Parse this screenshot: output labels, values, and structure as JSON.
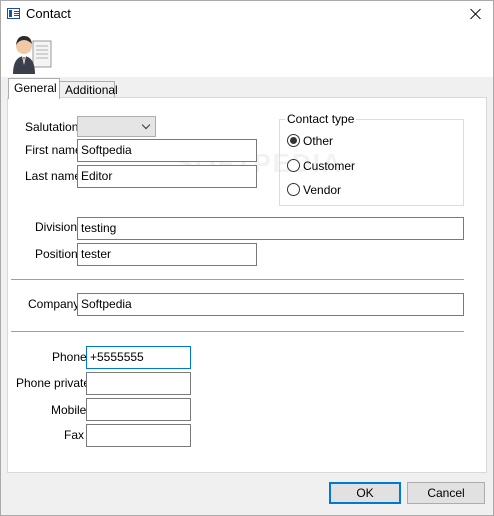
{
  "window": {
    "title": "Contact"
  },
  "tabs": [
    {
      "label": "General",
      "active": true
    },
    {
      "label": "Additional",
      "active": false
    }
  ],
  "form": {
    "salutation": {
      "label": "Salutation",
      "value": ""
    },
    "first_name": {
      "label": "First name",
      "value": "Softpedia"
    },
    "last_name": {
      "label": "Last name",
      "value": "Editor"
    },
    "division": {
      "label": "Division",
      "value": "testing"
    },
    "position": {
      "label": "Position",
      "value": "tester"
    },
    "company": {
      "label": "Company",
      "value": "Softpedia"
    },
    "phone": {
      "label": "Phone",
      "value": "+5555555"
    },
    "phone_private": {
      "label": "Phone private",
      "value": ""
    },
    "mobile": {
      "label": "Mobile",
      "value": ""
    },
    "fax": {
      "label": "Fax",
      "value": ""
    }
  },
  "contact_type": {
    "title": "Contact type",
    "options": [
      {
        "label": "Other",
        "checked": true
      },
      {
        "label": "Customer",
        "checked": false
      },
      {
        "label": "Vendor",
        "checked": false
      }
    ]
  },
  "watermark": "SOFTPEDIA",
  "buttons": {
    "ok": "OK",
    "cancel": "Cancel"
  },
  "icons": {
    "title": "address-card-icon",
    "header": "contact-person-icon"
  },
  "colors": {
    "focus": "#0078d7"
  }
}
